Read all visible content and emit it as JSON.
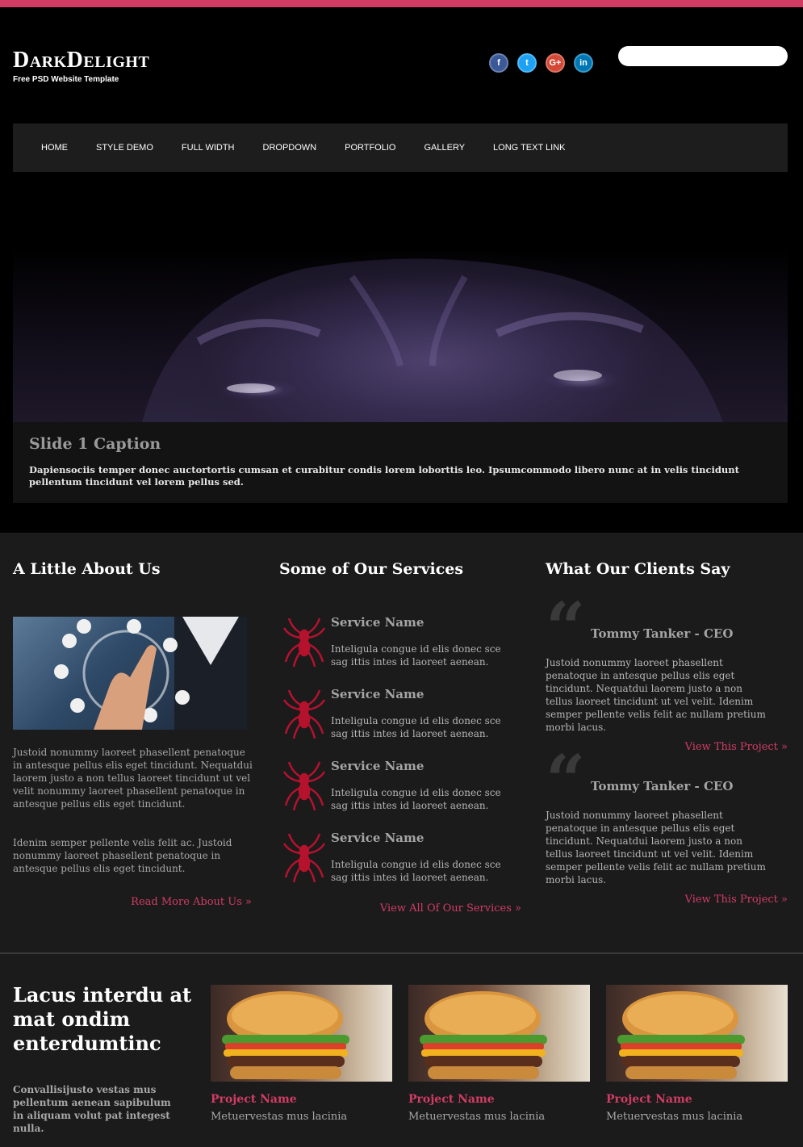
{
  "brand": {
    "logo": "DarkDelight",
    "tagline": "Free PSD Website Template",
    "accent": "#d23c63"
  },
  "social": [
    {
      "name": "facebook-icon",
      "glyph": "f",
      "color": "#3b5998"
    },
    {
      "name": "twitter-icon",
      "glyph": "t",
      "color": "#1da1f2"
    },
    {
      "name": "google-plus-icon",
      "glyph": "G+",
      "color": "#d34836"
    },
    {
      "name": "linkedin-icon",
      "glyph": "in",
      "color": "#0077b5"
    }
  ],
  "search": {
    "placeholder": "",
    "value": ""
  },
  "nav": [
    "HOME",
    "STYLE DEMO",
    "FULL WIDTH",
    "DROPDOWN",
    "PORTFOLIO",
    "GALLERY",
    "LONG TEXT LINK"
  ],
  "slider": {
    "caption_title": "Slide 1 Caption",
    "caption_text": "Dapiensociis temper donec auctortortis cumsan et curabitur condis lorem loborttis leo. Ipsumcommodo libero nunc at in velis tincidunt pellentum tincidunt vel lorem pellus sed."
  },
  "about": {
    "heading": "A Little About Us",
    "para1": "Justoid nonummy laoreet phasellent penatoque in antesque pellus elis eget tincidunt. Nequatdui laorem justo a non tellus laoreet tincidunt ut vel velit nonummy laoreet phasellent penatoque in antesque pellus elis eget tincidunt.",
    "para2": "Idenim semper pellente velis felit ac. Justoid nonummy laoreet phasellent penatoque in antesque pellus elis eget tincidunt.",
    "link": "Read More About Us »"
  },
  "services": {
    "heading": "Some of Our Services",
    "items": [
      {
        "name": "Service Name",
        "desc": "Inteligula congue id elis donec sce sag ittis intes id laoreet aenean."
      },
      {
        "name": "Service Name",
        "desc": "Inteligula congue id elis donec sce sag ittis intes id laoreet aenean."
      },
      {
        "name": "Service Name",
        "desc": "Inteligula congue id elis donec sce sag ittis intes id laoreet aenean."
      },
      {
        "name": "Service Name",
        "desc": "Inteligula congue id elis donec sce sag ittis intes id laoreet aenean."
      }
    ],
    "link": "View All Of Our Services »"
  },
  "clients": {
    "heading": "What Our Clients Say",
    "items": [
      {
        "name": "Tommy Tanker - CEO",
        "text": "Justoid nonummy laoreet phasellent penatoque in antesque pellus elis eget tincidunt. Nequatdui laorem justo a non tellus laoreet tincidunt ut vel velit. Idenim semper pellente velis felit ac nullam pretium morbi lacus.",
        "link": "View This Project »"
      },
      {
        "name": "Tommy Tanker - CEO",
        "text": "Justoid nonummy laoreet phasellent penatoque in antesque pellus elis eget tincidunt. Nequatdui laorem justo a non tellus laoreet tincidunt ut vel velit. Idenim semper pellente velis felit ac nullam pretium morbi lacus.",
        "link": "View This Project »"
      }
    ]
  },
  "portfolio": {
    "heading": "Lacus interdu at mat ondim enterdumtinc",
    "blurb": "Convallisijusto vestas mus pellentum aenean sapibulum in aliquam volut pat integest nulla.",
    "projects": [
      {
        "name": "Project Name",
        "desc": "Metuervestas mus lacinia"
      },
      {
        "name": "Project Name",
        "desc": "Metuervestas mus lacinia"
      },
      {
        "name": "Project Name",
        "desc": "Metuervestas mus lacinia"
      }
    ]
  }
}
